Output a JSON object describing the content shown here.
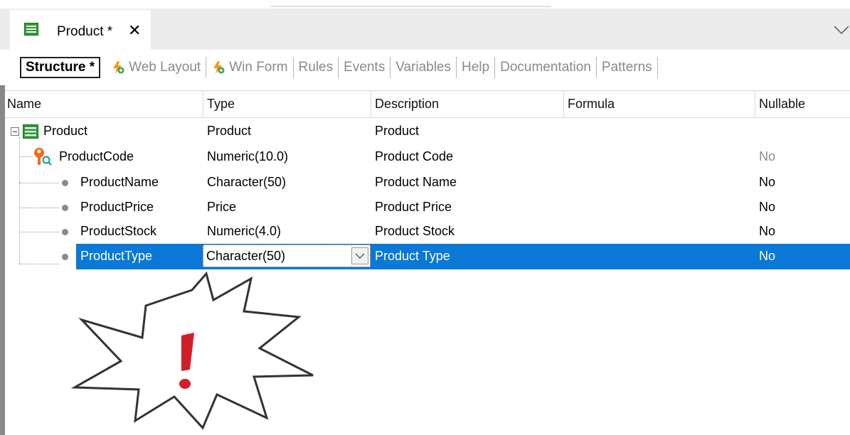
{
  "window": {
    "tab_title": "Product *",
    "tab_close": "✕"
  },
  "subtabs": {
    "active": "Structure *",
    "items": [
      "Web Layout",
      "Win Form",
      "Rules",
      "Events",
      "Variables",
      "Help",
      "Documentation",
      "Patterns"
    ]
  },
  "grid": {
    "columns": [
      "Name",
      "Type",
      "Description",
      "Formula",
      "Nullable"
    ],
    "root": {
      "name": "Product",
      "type": "Product",
      "description": "Product",
      "formula": "",
      "nullable": ""
    },
    "rows": [
      {
        "name": "ProductCode",
        "type": "Numeric(10.0)",
        "description": "Product Code",
        "formula": "",
        "nullable": "No",
        "key": true
      },
      {
        "name": "ProductName",
        "type": "Character(50)",
        "description": "Product Name",
        "formula": "",
        "nullable": "No"
      },
      {
        "name": "ProductPrice",
        "type": "Price",
        "description": "Product Price",
        "formula": "",
        "nullable": "No"
      },
      {
        "name": "ProductStock",
        "type": "Numeric(4.0)",
        "description": "Product Stock",
        "formula": "",
        "nullable": "No"
      },
      {
        "name": "ProductType",
        "type": "Character(50)",
        "description": "Product Type",
        "formula": "",
        "nullable": "No",
        "selected": true
      }
    ]
  },
  "colors": {
    "selection": "#0a78d7",
    "warning": "#d11f2a",
    "accent_orange": "#f39a1e",
    "accent_green": "#3a9c3a"
  }
}
